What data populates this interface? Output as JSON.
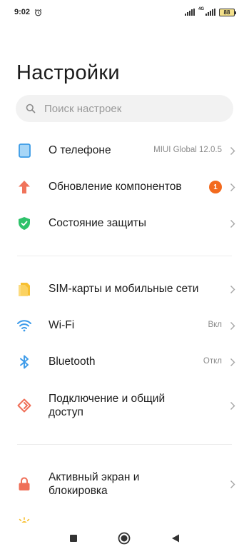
{
  "status_bar": {
    "time": "9:02",
    "network_type": "4G",
    "battery": "88"
  },
  "title": "Настройки",
  "search": {
    "placeholder": "Поиск настроек"
  },
  "sections": [
    {
      "items": [
        {
          "label": "О телефоне",
          "value": "MIUI Global 12.0.5",
          "icon": "phone-icon",
          "color": "#4aa8ec"
        },
        {
          "label": "Обновление компонентов",
          "badge": "1",
          "icon": "update-arrow-icon",
          "color": "#f0735a"
        },
        {
          "label": "Состояние защиты",
          "icon": "shield-check-icon",
          "color": "#2ec26a"
        }
      ]
    },
    {
      "items": [
        {
          "label": "SIM-карты и мобильные сети",
          "icon": "sim-card-icon",
          "color": "#f7c032"
        },
        {
          "label": "Wi-Fi",
          "value": "Вкл",
          "icon": "wifi-icon",
          "color": "#3d9be9"
        },
        {
          "label": "Bluetooth",
          "value": "Откл",
          "icon": "bluetooth-icon",
          "color": "#3d9be9"
        },
        {
          "label": "Подключение и общий\nдоступ",
          "label_line1": "Подключение и общий",
          "label_line2": "доступ",
          "icon": "connection-sharing-icon",
          "color": "#ef6f58"
        }
      ]
    },
    {
      "items": [
        {
          "label_line1": "Активный экран и",
          "label_line2": "блокировка",
          "icon": "lock-icon",
          "color": "#ef6f58"
        },
        {
          "icon": "brightness-icon",
          "color": "#f7c032"
        }
      ]
    }
  ],
  "nav": {
    "back": "back-icon",
    "home": "home-icon",
    "recents": "recents-icon"
  }
}
